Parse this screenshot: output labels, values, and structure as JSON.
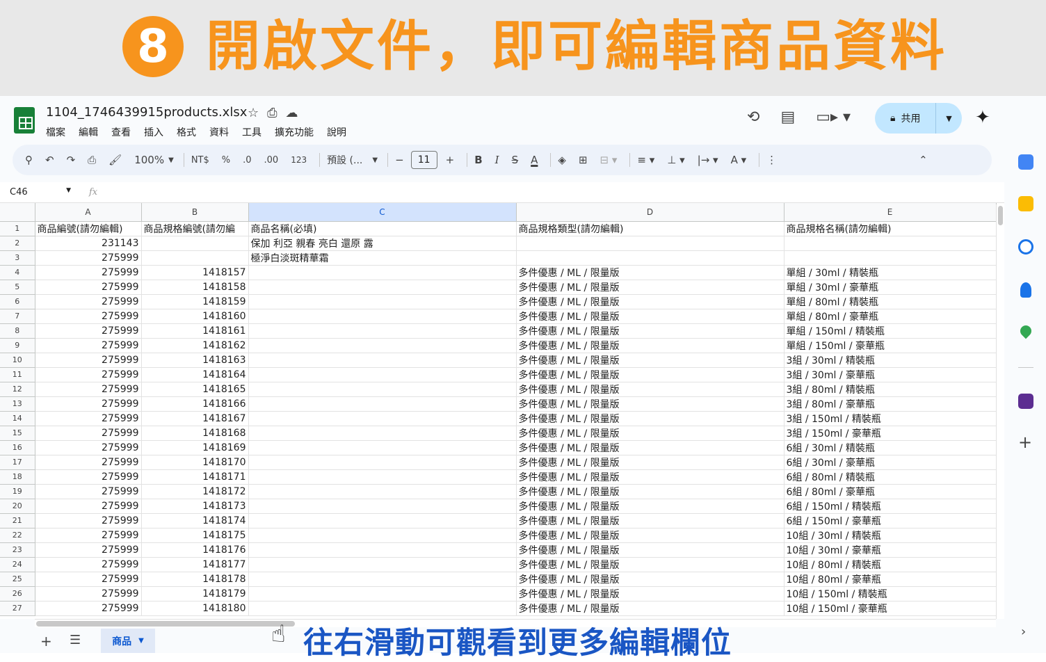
{
  "banner": {
    "step": "8",
    "title": "開啟文件，即可編輯商品資料"
  },
  "file": {
    "name": "1104_1746439915products.xlsx"
  },
  "menu": [
    "檔案",
    "編輯",
    "查看",
    "插入",
    "格式",
    "資料",
    "工具",
    "擴充功能",
    "說明"
  ],
  "share": {
    "label": "共用"
  },
  "toolbar": {
    "zoom": "100%",
    "currency": "NT$",
    "percent": "%",
    "dec_decrease": ".0",
    "dec_increase": ".00",
    "number_format": "123",
    "font": "預設 (...",
    "font_size": "11"
  },
  "namebox": "C46",
  "fx": "fx",
  "columns": [
    "A",
    "B",
    "C",
    "D",
    "E"
  ],
  "selected_column": "C",
  "header_row": [
    "商品編號(請勿編輯)",
    "商品規格編號(請勿編",
    "商品名稱(必填)",
    "商品規格類型(請勿編輯)",
    "商品規格名稱(請勿編輯)"
  ],
  "rows": [
    [
      "231143",
      "",
      "保加 利亞 親春 亮白 還原 露",
      "",
      ""
    ],
    [
      "275999",
      "",
      "極淨白淡斑精華霜",
      "",
      ""
    ],
    [
      "275999",
      "1418157",
      "",
      "多件優惠 / ML / 限量版",
      "單組 / 30ml / 精裝瓶"
    ],
    [
      "275999",
      "1418158",
      "",
      "多件優惠 / ML / 限量版",
      "單組 / 30ml / 豪華瓶"
    ],
    [
      "275999",
      "1418159",
      "",
      "多件優惠 / ML / 限量版",
      "單組 / 80ml / 精裝瓶"
    ],
    [
      "275999",
      "1418160",
      "",
      "多件優惠 / ML / 限量版",
      "單組 / 80ml / 豪華瓶"
    ],
    [
      "275999",
      "1418161",
      "",
      "多件優惠 / ML / 限量版",
      "單組 / 150ml / 精裝瓶"
    ],
    [
      "275999",
      "1418162",
      "",
      "多件優惠 / ML / 限量版",
      "單組 / 150ml / 豪華瓶"
    ],
    [
      "275999",
      "1418163",
      "",
      "多件優惠 / ML / 限量版",
      "3組 / 30ml / 精裝瓶"
    ],
    [
      "275999",
      "1418164",
      "",
      "多件優惠 / ML / 限量版",
      "3組 / 30ml / 豪華瓶"
    ],
    [
      "275999",
      "1418165",
      "",
      "多件優惠 / ML / 限量版",
      "3組 / 80ml / 精裝瓶"
    ],
    [
      "275999",
      "1418166",
      "",
      "多件優惠 / ML / 限量版",
      "3組 / 80ml / 豪華瓶"
    ],
    [
      "275999",
      "1418167",
      "",
      "多件優惠 / ML / 限量版",
      "3組 / 150ml / 精裝瓶"
    ],
    [
      "275999",
      "1418168",
      "",
      "多件優惠 / ML / 限量版",
      "3組 / 150ml / 豪華瓶"
    ],
    [
      "275999",
      "1418169",
      "",
      "多件優惠 / ML / 限量版",
      "6組 / 30ml / 精裝瓶"
    ],
    [
      "275999",
      "1418170",
      "",
      "多件優惠 / ML / 限量版",
      "6組 / 30ml / 豪華瓶"
    ],
    [
      "275999",
      "1418171",
      "",
      "多件優惠 / ML / 限量版",
      "6組 / 80ml / 精裝瓶"
    ],
    [
      "275999",
      "1418172",
      "",
      "多件優惠 / ML / 限量版",
      "6組 / 80ml / 豪華瓶"
    ],
    [
      "275999",
      "1418173",
      "",
      "多件優惠 / ML / 限量版",
      "6組 / 150ml / 精裝瓶"
    ],
    [
      "275999",
      "1418174",
      "",
      "多件優惠 / ML / 限量版",
      "6組 / 150ml / 豪華瓶"
    ],
    [
      "275999",
      "1418175",
      "",
      "多件優惠 / ML / 限量版",
      "10組 / 30ml / 精裝瓶"
    ],
    [
      "275999",
      "1418176",
      "",
      "多件優惠 / ML / 限量版",
      "10組 / 30ml / 豪華瓶"
    ],
    [
      "275999",
      "1418177",
      "",
      "多件優惠 / ML / 限量版",
      "10組 / 80ml / 精裝瓶"
    ],
    [
      "275999",
      "1418178",
      "",
      "多件優惠 / ML / 限量版",
      "10組 / 80ml / 豪華瓶"
    ],
    [
      "275999",
      "1418179",
      "",
      "多件優惠 / ML / 限量版",
      "10組 / 150ml / 精裝瓶"
    ],
    [
      "275999",
      "1418180",
      "",
      "多件優惠 / ML / 限量版",
      "10組 / 150ml / 豪華瓶"
    ]
  ],
  "sheet_tab": {
    "label": "商品"
  },
  "hint": "往右滑動可觀看到更多編輯欄位",
  "colors": {
    "accent_orange": "#f7941d",
    "hint_blue": "#1a56c4",
    "share_bg": "#c2e7ff",
    "sheets_green": "#188038"
  }
}
